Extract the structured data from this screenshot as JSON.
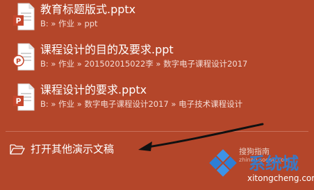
{
  "recent": [
    {
      "name": "教育标题版式.pptx",
      "path": "B: » 作业 » ppt"
    },
    {
      "name": "课程设计的目的及要求.ppt",
      "path": "B: » 作业 » 2015020150​22李 » 数字电子课程设计2017"
    },
    {
      "name": "课程设计的要求.pptx",
      "path": "B: » 作业 » 数字电子课程设计2017 » 电子技术课程设计"
    }
  ],
  "open_other": {
    "label": "打开其他演示文稿"
  },
  "watermark": {
    "top_text": "搜狗指南",
    "sub_text": "zhinan.sogou.com",
    "brand": "系统城",
    "domain": "xitongcheng.com"
  },
  "colors": {
    "background": "#b4462a",
    "ppt_badge": "#c6472d",
    "watermark_blue": "#2d7fd6"
  }
}
